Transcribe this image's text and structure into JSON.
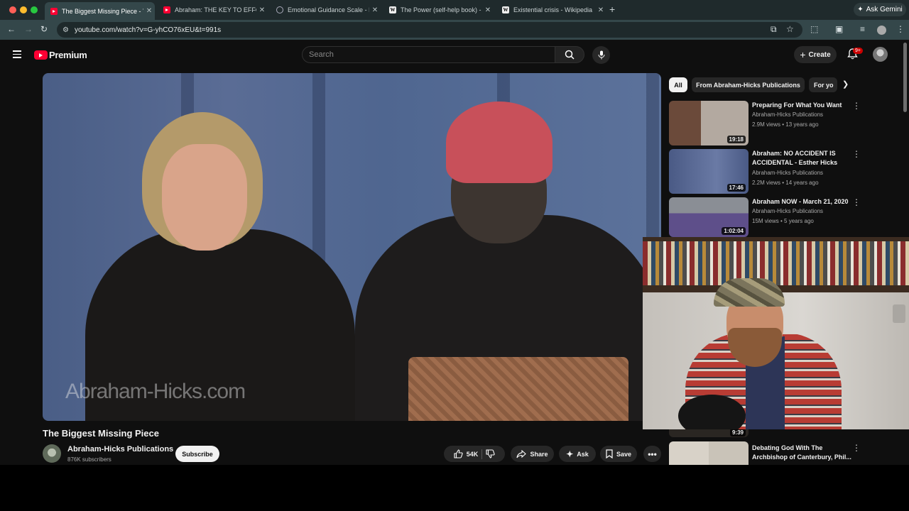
{
  "browser": {
    "tabs": [
      {
        "title": "The Biggest Missing Piece - Y",
        "favicon": "youtube-icon",
        "active": true
      },
      {
        "title": "Abraham: THE KEY TO EFFOR",
        "favicon": "youtube-icon",
        "active": false
      },
      {
        "title": "Emotional Guidance Scale - I",
        "favicon": "globe-icon",
        "active": false
      },
      {
        "title": "The Power (self-help book) -",
        "favicon": "wikipedia-icon",
        "active": false
      },
      {
        "title": "Existential crisis - Wikipedia",
        "favicon": "wikipedia-icon",
        "active": false
      }
    ],
    "new_tab": "+",
    "ask_gemini": "Ask Gemini",
    "url": "youtube.com/watch?v=G-yhCO76xEU&t=991s",
    "colors": {
      "tabbar": "#1f2a2c",
      "toolbar": "#34474a"
    }
  },
  "youtube": {
    "logo_text": "Premium",
    "search_placeholder": "Search",
    "create_label": "Create",
    "notification_count": "9+",
    "video": {
      "watermark": "Abraham-Hicks.com",
      "title": "The Biggest Missing Piece",
      "channel": "Abraham-Hicks Publications",
      "subscribers": "876K subscribers",
      "subscribe_label": "Subscribe",
      "likes": "54K",
      "share_label": "Share",
      "ask_label": "Ask",
      "save_label": "Save"
    },
    "chips": [
      "All",
      "From Abraham-Hicks Publications",
      "For yo"
    ],
    "recommendations": [
      {
        "title": "Preparing For What You Want",
        "channel": "Abraham-Hicks Publications",
        "meta": "2.9M views • 13 years ago",
        "duration": "19:18"
      },
      {
        "title": "Abraham: NO ACCIDENT IS ACCIDENTAL - Esther Hicks",
        "channel": "Abraham-Hicks Publications",
        "meta": "2.2M views • 14 years ago",
        "duration": "17:46"
      },
      {
        "title": "Abraham NOW - March 21, 2020",
        "channel": "Abraham-Hicks Publications",
        "meta": "15M views • 5 years ago",
        "duration": "1:02:04"
      },
      {
        "title": "",
        "channel": "",
        "meta": "",
        "duration": "9:39"
      },
      {
        "title": "Debating God With The Archbishop of Canterbury, Phil...",
        "channel": "",
        "meta": "",
        "duration": ""
      }
    ],
    "colors": {
      "brand": "#ff0033",
      "background": "#0f0f0f"
    }
  }
}
